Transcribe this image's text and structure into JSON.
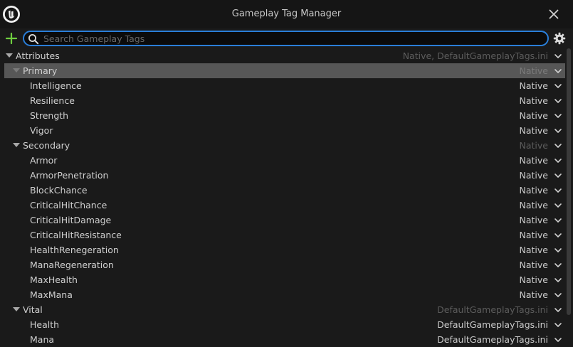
{
  "window": {
    "title": "Gameplay Tag Manager"
  },
  "search": {
    "placeholder": "Search Gameplay Tags",
    "value": ""
  },
  "colors": {
    "accent": "#2a7ed8",
    "add": "#6fcf3f",
    "selected_row": "#575757"
  },
  "icons": {
    "logo": "unreal-logo-icon",
    "close": "close-icon",
    "add": "plus-icon",
    "search": "search-icon",
    "settings": "gear-icon",
    "expand": "chevron-down-icon"
  },
  "tree": [
    {
      "label": "Attributes",
      "source": "Native, DefaultGameplayTags.ini",
      "depth": 0,
      "expandable": true,
      "dim": true
    },
    {
      "label": "Primary",
      "source": "Native",
      "depth": 1,
      "expandable": true,
      "selected": true
    },
    {
      "label": "Intelligence",
      "source": "Native",
      "depth": 2
    },
    {
      "label": "Resilience",
      "source": "Native",
      "depth": 2
    },
    {
      "label": "Strength",
      "source": "Native",
      "depth": 2
    },
    {
      "label": "Vigor",
      "source": "Native",
      "depth": 2
    },
    {
      "label": "Secondary",
      "source": "Native",
      "depth": 1,
      "expandable": true,
      "dim": true
    },
    {
      "label": "Armor",
      "source": "Native",
      "depth": 2
    },
    {
      "label": "ArmorPenetration",
      "source": "Native",
      "depth": 2
    },
    {
      "label": "BlockChance",
      "source": "Native",
      "depth": 2
    },
    {
      "label": "CriticalHitChance",
      "source": "Native",
      "depth": 2
    },
    {
      "label": "CriticalHitDamage",
      "source": "Native",
      "depth": 2
    },
    {
      "label": "CriticalHitResistance",
      "source": "Native",
      "depth": 2
    },
    {
      "label": "HealthRenegeration",
      "source": "Native",
      "depth": 2
    },
    {
      "label": "ManaRegeneration",
      "source": "Native",
      "depth": 2
    },
    {
      "label": "MaxHealth",
      "source": "Native",
      "depth": 2
    },
    {
      "label": "MaxMana",
      "source": "Native",
      "depth": 2
    },
    {
      "label": "Vital",
      "source": "DefaultGameplayTags.ini",
      "depth": 1,
      "expandable": true,
      "dim": true
    },
    {
      "label": "Health",
      "source": "DefaultGameplayTags.ini",
      "depth": 2
    },
    {
      "label": "Mana",
      "source": "DefaultGameplayTags.ini",
      "depth": 2
    }
  ]
}
